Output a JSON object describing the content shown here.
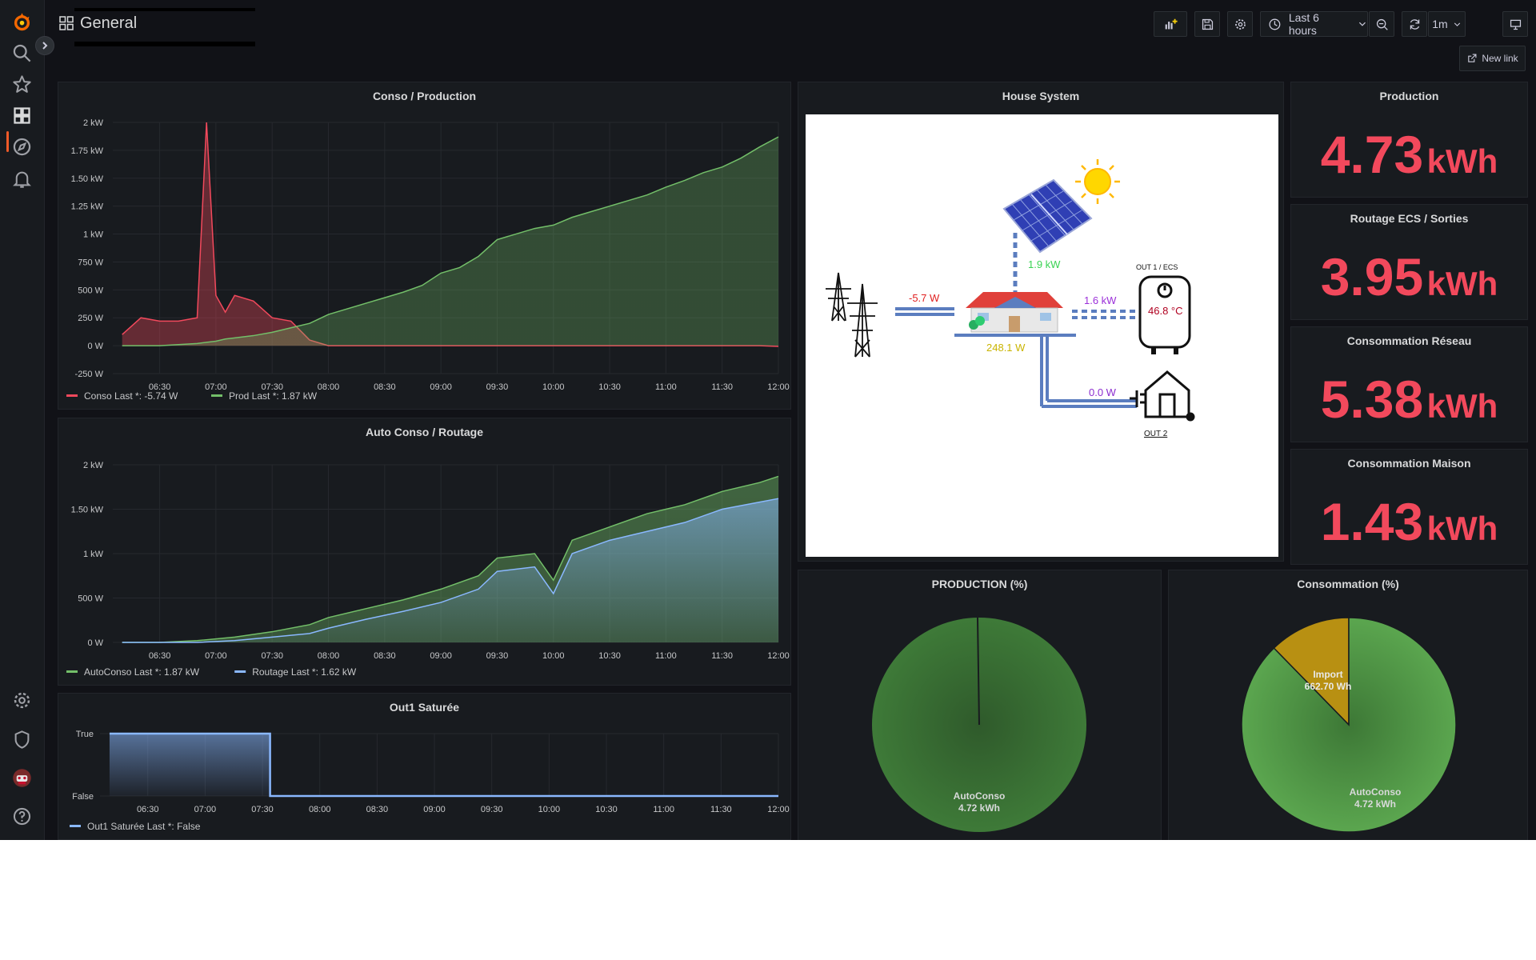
{
  "app": {
    "title": "General"
  },
  "sidebar": {
    "items": [
      {
        "icon": "grafana-logo-icon"
      },
      {
        "icon": "search-icon"
      },
      {
        "icon": "star-icon"
      },
      {
        "icon": "dashboards-icon"
      },
      {
        "icon": "compass-icon"
      },
      {
        "icon": "bell-icon"
      },
      {
        "icon": "gear-icon"
      },
      {
        "icon": "shield-icon"
      },
      {
        "icon": "user-avatar-icon"
      },
      {
        "icon": "help-icon"
      }
    ]
  },
  "toolbar": {
    "time_range": "Last 6 hours",
    "refresh_interval": "1m",
    "new_link_label": "New link"
  },
  "time_axis_ticks": [
    "06:30",
    "07:00",
    "07:30",
    "08:00",
    "08:30",
    "09:00",
    "09:30",
    "10:00",
    "10:30",
    "11:00",
    "11:30",
    "12:00"
  ],
  "panels": {
    "conso_production": {
      "title": "Conso / Production",
      "y_ticks": [
        "2 kW",
        "1.75 kW",
        "1.50 kW",
        "1.25 kW",
        "1 kW",
        "750 W",
        "500 W",
        "250 W",
        "0 W",
        "-250 W"
      ],
      "legend": [
        {
          "name": "Conso",
          "last": "Last *: -5.74 W",
          "color": "#f2495c"
        },
        {
          "name": "Prod",
          "last": "Last *: 1.87 kW",
          "color": "#73bf69"
        }
      ]
    },
    "auto_conso": {
      "title": "Auto Conso / Routage",
      "y_ticks": [
        "2 kW",
        "1.50 kW",
        "1 kW",
        "500 W",
        "0 W"
      ],
      "legend": [
        {
          "name": "AutoConso",
          "last": "Last *: 1.87 kW",
          "color": "#73bf69"
        },
        {
          "name": "Routage",
          "last": "Last *: 1.62 kW",
          "color": "#8ab8ff"
        }
      ]
    },
    "out1": {
      "title": "Out1 Saturée",
      "y_ticks": [
        "True",
        "False"
      ],
      "legend": [
        {
          "name": "Out1 Saturée",
          "last": "Last *: False",
          "color": "#8ab8ff"
        }
      ]
    },
    "house": {
      "title": "House System",
      "grid_power": "-5.7 W",
      "solar_power": "1.9 kW",
      "house_power": "248.1 W",
      "out1_power": "1.6 kW",
      "out2_power": "0.0 W",
      "out1_label": "OUT 1 / ECS",
      "out2_label": "OUT 2",
      "temperature": "46.8 °C"
    },
    "stats": [
      {
        "title": "Production",
        "value": "4.73",
        "unit": "kWh"
      },
      {
        "title": "Routage ECS / Sorties",
        "value": "3.95",
        "unit": "kWh"
      },
      {
        "title": "Consommation Réseau",
        "value": "5.38",
        "unit": "kWh"
      },
      {
        "title": "Consommation Maison",
        "value": "1.43",
        "unit": "kWh"
      }
    ],
    "production_pct": {
      "title": "PRODUCTION (%)",
      "slices": [
        {
          "label": "AutoConso",
          "value": "4.72 kWh"
        }
      ]
    },
    "consommation_pct": {
      "title": "Consommation (%)",
      "slices": [
        {
          "label": "AutoConso",
          "value": "4.72 kWh"
        },
        {
          "label": "Import",
          "value": "662.70 Wh"
        }
      ]
    }
  },
  "chart_data": [
    {
      "type": "area",
      "title": "Conso / Production",
      "x": [
        "06:10",
        "06:20",
        "06:30",
        "06:40",
        "06:50",
        "06:55",
        "07:00",
        "07:05",
        "07:10",
        "07:20",
        "07:30",
        "07:40",
        "07:50",
        "08:00",
        "08:10",
        "08:20",
        "08:30",
        "08:40",
        "08:50",
        "09:00",
        "09:10",
        "09:20",
        "09:30",
        "09:40",
        "09:50",
        "10:00",
        "10:10",
        "10:20",
        "10:30",
        "10:40",
        "10:50",
        "11:00",
        "11:10",
        "11:20",
        "11:30",
        "11:40",
        "11:50",
        "12:00"
      ],
      "ylim": [
        -250,
        2000
      ],
      "series": [
        {
          "name": "Conso",
          "values": [
            100,
            250,
            220,
            220,
            250,
            2000,
            450,
            300,
            450,
            400,
            250,
            220,
            50,
            0,
            0,
            0,
            0,
            0,
            0,
            0,
            0,
            0,
            0,
            0,
            0,
            0,
            0,
            0,
            0,
            0,
            0,
            0,
            0,
            0,
            0,
            0,
            0,
            -6
          ]
        },
        {
          "name": "Prod",
          "values": [
            0,
            0,
            0,
            10,
            20,
            30,
            40,
            60,
            70,
            90,
            120,
            160,
            200,
            280,
            330,
            380,
            430,
            480,
            540,
            650,
            700,
            800,
            950,
            1000,
            1050,
            1080,
            1150,
            1200,
            1250,
            1300,
            1350,
            1420,
            1480,
            1550,
            1600,
            1680,
            1780,
            1870
          ]
        }
      ]
    },
    {
      "type": "area",
      "title": "Auto Conso / Routage",
      "x": [
        "06:10",
        "06:30",
        "06:50",
        "07:10",
        "07:30",
        "07:50",
        "08:00",
        "08:20",
        "08:40",
        "09:00",
        "09:20",
        "09:30",
        "09:50",
        "10:00",
        "10:10",
        "10:30",
        "10:50",
        "11:10",
        "11:30",
        "11:50",
        "12:00"
      ],
      "ylim": [
        0,
        2000
      ],
      "series": [
        {
          "name": "AutoConso",
          "values": [
            0,
            0,
            20,
            60,
            120,
            200,
            280,
            380,
            480,
            600,
            750,
            950,
            1000,
            700,
            1150,
            1300,
            1450,
            1550,
            1700,
            1800,
            1870
          ]
        },
        {
          "name": "Routage",
          "values": [
            0,
            0,
            0,
            20,
            60,
            100,
            160,
            260,
            350,
            450,
            600,
            800,
            850,
            550,
            1000,
            1150,
            1250,
            1350,
            1500,
            1580,
            1620
          ]
        }
      ]
    },
    {
      "type": "line",
      "title": "Out1 Saturée",
      "x": [
        "06:10",
        "07:34",
        "07:35",
        "12:00"
      ],
      "series": [
        {
          "name": "Out1 Saturée",
          "values": [
            1,
            1,
            0,
            0
          ]
        }
      ]
    },
    {
      "type": "pie",
      "title": "PRODUCTION (%)",
      "slices": [
        {
          "label": "AutoConso",
          "value": 4.72,
          "unit": "kWh"
        }
      ]
    },
    {
      "type": "pie",
      "title": "Consommation (%)",
      "slices": [
        {
          "label": "AutoConso",
          "value": 4.72,
          "unit": "kWh"
        },
        {
          "label": "Import",
          "value": 0.6627,
          "unit": "kWh"
        }
      ]
    }
  ],
  "colors": {
    "red": "#f2495c",
    "green": "#73bf69",
    "blue": "#8ab8ff",
    "orange": "#f05a28",
    "import_yellow": "#c29409"
  }
}
